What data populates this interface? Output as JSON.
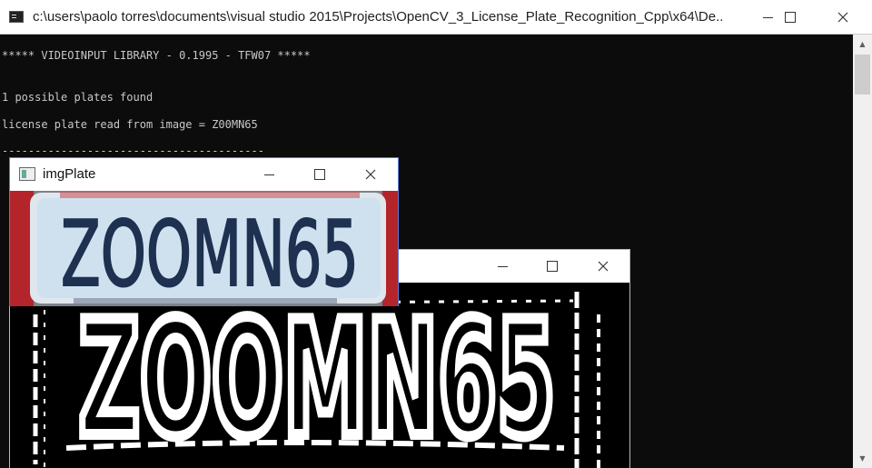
{
  "console": {
    "title": "c:\\users\\paolo torres\\documents\\visual studio 2015\\Projects\\OpenCV_3_License_Plate_Recognition_Cpp\\x64\\De...",
    "lines": [
      "***** VIDEOINPUT LIBRARY - 0.1995 - TFW07 *****",
      "1 possible plates found",
      "license plate read from image = Z00MN65",
      "----------------------------------------"
    ]
  },
  "img_plate_window": {
    "title": "imgPlate",
    "plate_text": "ZOOMN65"
  },
  "threshold_window": {
    "plate_text": "ZOOMN65"
  },
  "colors": {
    "console_bg": "#0c0c0c",
    "console_text": "#c8c8c8",
    "plate_bg": "#cfe1ef",
    "plate_text": "#1e3150",
    "plate_frame_red": "#b3252a",
    "window_border_active": "#5b7bd6"
  },
  "icons": {
    "console_app": "console-app-icon",
    "opencv_window": "opencv-window-icon",
    "minimize": "minimize-icon",
    "maximize": "maximize-icon",
    "close": "close-icon"
  }
}
